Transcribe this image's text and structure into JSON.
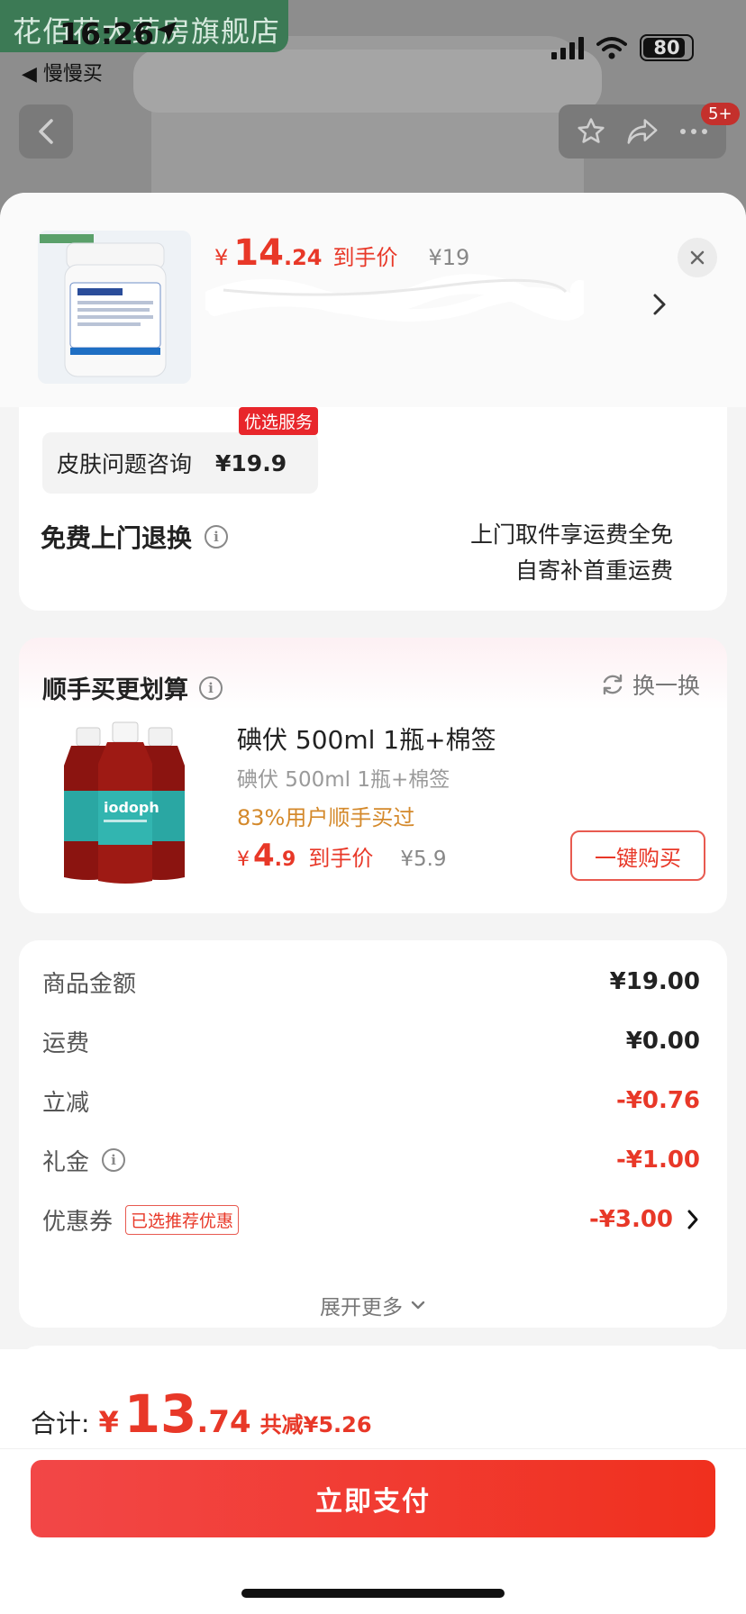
{
  "status_bar": {
    "time": "16:26",
    "battery": "80",
    "back_app": "◀ 慢慢买"
  },
  "shop": {
    "name": "花佰花大药房旗舰店"
  },
  "nav": {
    "badge": "5+"
  },
  "header_product": {
    "price_symbol": "¥",
    "price_int": "14",
    "price_dec": ".24",
    "price_tag": "到手价",
    "original_price": "¥19",
    "image_icon": "jar-product-image"
  },
  "service": {
    "name": "皮肤问题咨询",
    "price": "¥19.9",
    "badge": "优选服务"
  },
  "return_policy": {
    "title": "免费上门退换",
    "line1": "上门取件享运费全免",
    "line2": "自寄补首重运费"
  },
  "addon": {
    "title": "顺手买更划算",
    "refresh_label": "换一换",
    "name": "碘伏 500ml 1瓶+棉签",
    "subtitle": "碘伏 500ml 1瓶+棉签",
    "users": "83%用户顺手买过",
    "price_symbol": "¥",
    "price_int": "4",
    "price_dec": ".9",
    "price_tag": "到手价",
    "original_price": "¥5.9",
    "buy_label": "一键购买",
    "bottle_label": "iodoph"
  },
  "summary": {
    "rows": [
      {
        "label": "商品金额",
        "value": "¥19.00"
      },
      {
        "label": "运费",
        "value": "¥0.00"
      },
      {
        "label": "立减",
        "value": "-¥0.76"
      },
      {
        "label": "礼金",
        "value": "-¥1.00"
      },
      {
        "label": "优惠券",
        "value": "-¥3.00",
        "tag": "已选推荐优惠"
      }
    ],
    "expand_label": "展开更多"
  },
  "footer": {
    "total_label": "合计:",
    "total_symbol": "¥",
    "total_int": "13",
    "total_dec": ".74",
    "saved": "共减¥5.26",
    "pay_label": "立即支付"
  },
  "colors": {
    "accent": "#e83828",
    "orange": "#d4892b",
    "pay_start": "#f24747",
    "pay_end": "#f0301e"
  }
}
